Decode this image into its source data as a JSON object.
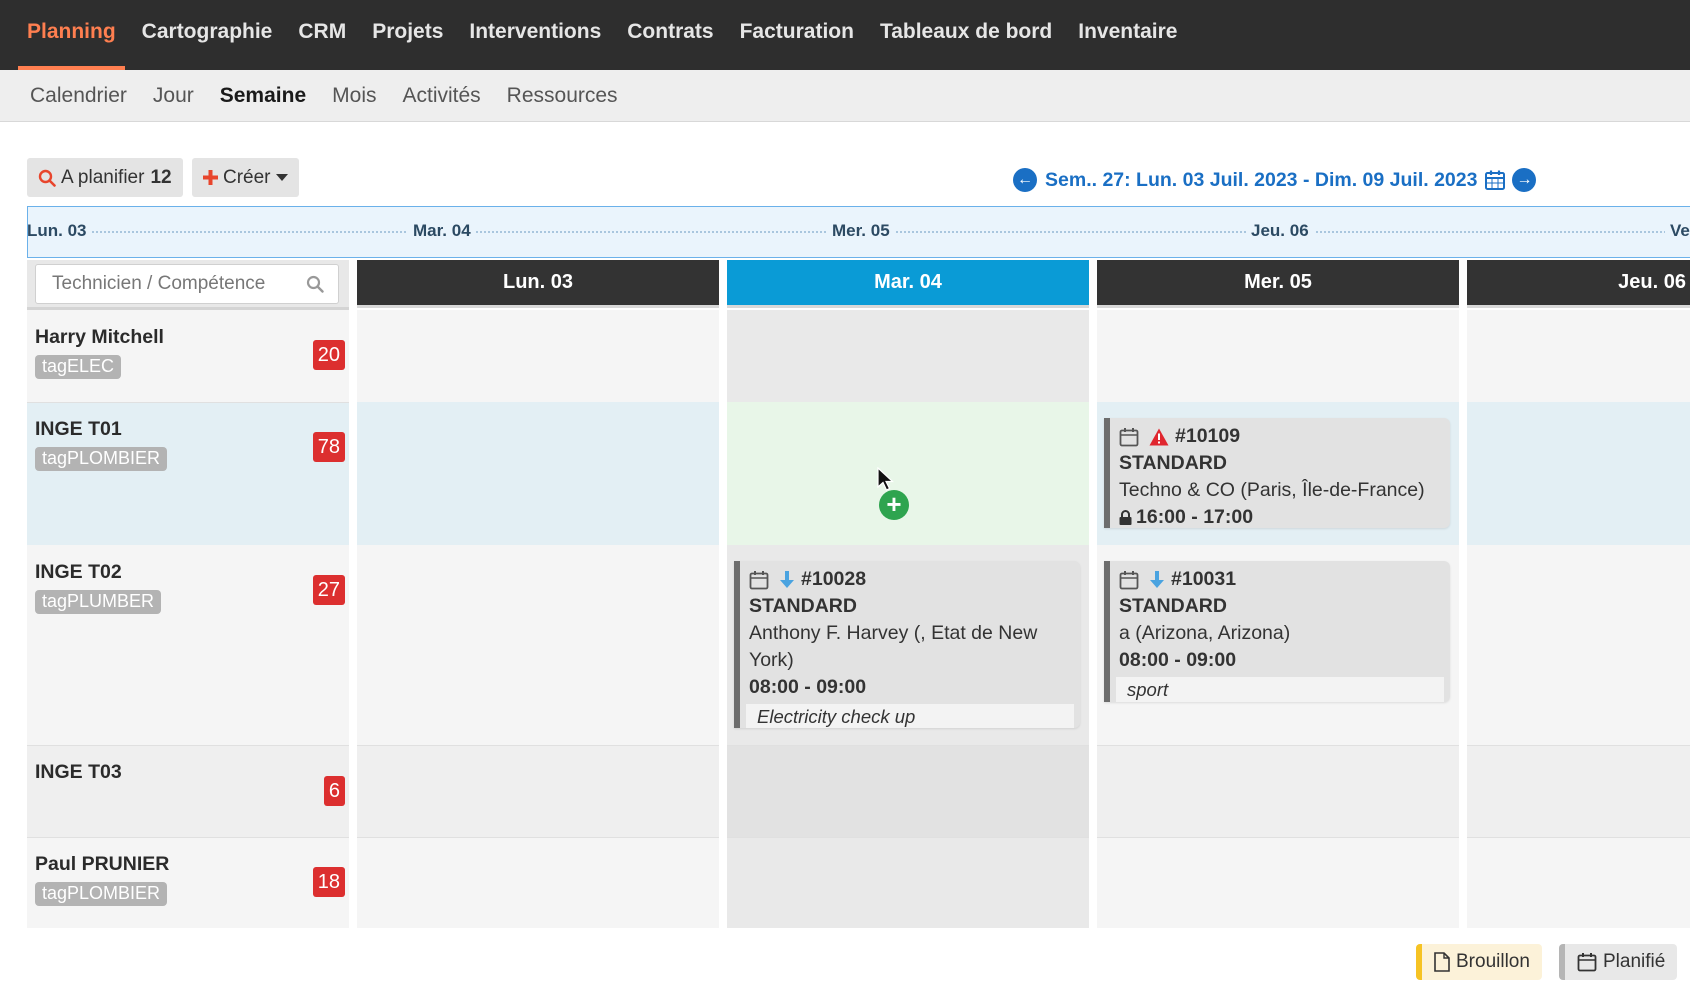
{
  "topnav": {
    "items": [
      "Planning",
      "Cartographie",
      "CRM",
      "Projets",
      "Interventions",
      "Contrats",
      "Facturation",
      "Tableaux de bord",
      "Inventaire"
    ],
    "active": "Planning"
  },
  "subnav": {
    "items": [
      "Calendrier",
      "Jour",
      "Semaine",
      "Mois",
      "Activités",
      "Ressources"
    ],
    "active": "Semaine"
  },
  "toolbar": {
    "to_plan_label": "A planifier",
    "to_plan_count": "12",
    "create_label": "Créer",
    "week_label": "Sem.. 27: Lun. 03 Juil. 2023 - Dim. 09 Juil. 2023"
  },
  "timeline": {
    "labels": [
      "Lun. 03",
      "Mar. 04",
      "Mer. 05",
      "Jeu. 06",
      "Ve"
    ]
  },
  "search": {
    "placeholder": "Technicien / Compétence"
  },
  "days": [
    "Lun. 03",
    "Mar. 04",
    "Mer. 05",
    "Jeu. 06"
  ],
  "today_index": 1,
  "technicians": [
    {
      "name": "Harry Mitchell",
      "tag": "tagELEC",
      "count": "20"
    },
    {
      "name": "INGE T01",
      "tag": "tagPLOMBIER",
      "count": "78"
    },
    {
      "name": "INGE T02",
      "tag": "tagPLUMBER",
      "count": "27"
    },
    {
      "name": "INGE T03",
      "tag": "",
      "count": "6"
    },
    {
      "name": "Paul PRUNIER",
      "tag": "tagPLOMBIER",
      "count": "18"
    }
  ],
  "events": {
    "e10109": {
      "id": "#10109",
      "type": "STANDARD",
      "client": "Techno & CO (Paris, Île-de-France)",
      "time": "16:00 - 17:00",
      "priority_icon": "warning-icon",
      "locked": true
    },
    "e10028": {
      "id": "#10028",
      "type": "STANDARD",
      "client": "Anthony F. Harvey (, Etat de New York)",
      "time": "08:00 - 09:00",
      "note": "Electricity check up",
      "priority_icon": "arrow-down-icon"
    },
    "e10031": {
      "id": "#10031",
      "type": "STANDARD",
      "client": "a (Arizona, Arizona)",
      "time": "08:00 - 09:00",
      "note": "sport",
      "priority_icon": "arrow-down-icon"
    }
  },
  "legend": {
    "draft_label": "Brouillon",
    "planned_label": "Planifié"
  },
  "colors": {
    "accent": "#ff7f50",
    "today": "#0a9bd6",
    "link": "#1a6fc4",
    "badge": "#dc2f2f",
    "add": "#2ea44f",
    "highlight_row": "#e3eff4",
    "highlight_cell": "#e8f6e8"
  }
}
